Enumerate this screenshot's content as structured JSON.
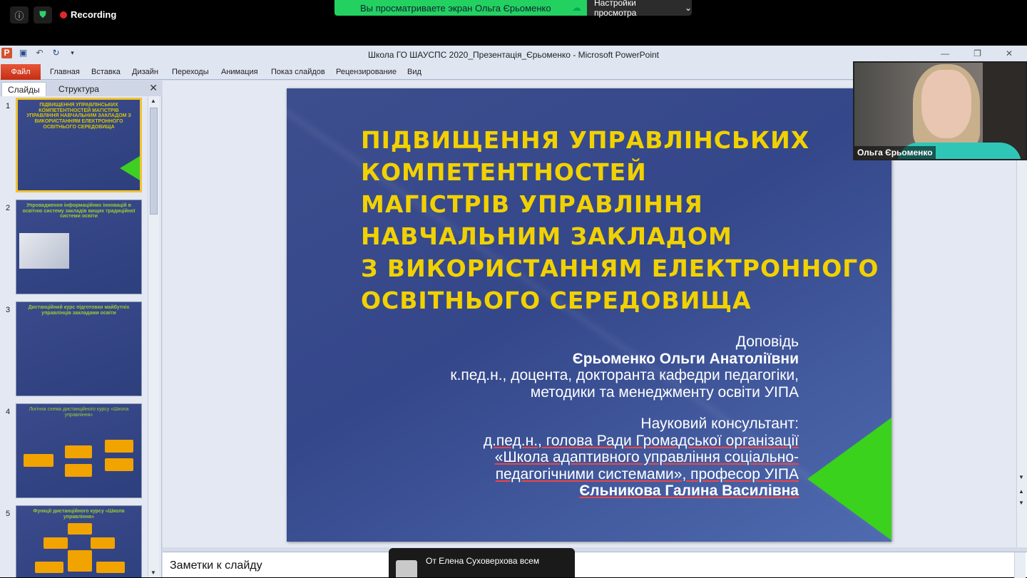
{
  "zoom": {
    "recording_label": "Recording",
    "share_banner": "Вы просматриваете экран Ольга Єрьоменко",
    "view_settings_label": "Настройки просмотра"
  },
  "window": {
    "title": "Школа ГО ШАУСПС 2020_Презентація_Єрьоменко  -  Microsoft PowerPoint"
  },
  "ribbon": {
    "file": "Файл",
    "tabs": [
      "Главная",
      "Вставка",
      "Дизайн",
      "Переходы",
      "Анимация",
      "Показ слайдов",
      "Рецензирование",
      "Вид"
    ]
  },
  "left_panel": {
    "tab_slides": "Слайды",
    "tab_outline": "Структура"
  },
  "thumbnails": [
    {
      "num": "1",
      "title": "ПІДВИЩЕННЯ УПРАВЛІНСЬКИХ КОМПЕТЕНТНОСТЕЙ МАГІСТРІВ УПРАВЛІННЯ НАВЧАЛЬНИМ ЗАКЛАДОМ З ВИКОРИСТАННЯМ ЕЛЕКТРОННОГО ОСВІТНЬОГО СЕРЕДОВИЩА"
    },
    {
      "num": "2",
      "title": "Упровадження інформаційних інновацій в освітню систему закладів вищих традиційної системи освіти"
    },
    {
      "num": "3",
      "title": "Дистанційний курс підготовки майбутніх управлінців закладами освіти"
    },
    {
      "num": "4",
      "title": "Логічна схема дистанційного курсу «Школа управління»"
    },
    {
      "num": "5",
      "title": "Функції дистанційного курсу «Школа управління»"
    }
  ],
  "slide": {
    "title_lines": [
      "ПІДВИЩЕННЯ УПРАВЛІНСЬКИХ",
      "КОМПЕТЕНТНОСТЕЙ",
      "МАГІСТРІВ УПРАВЛІННЯ",
      "НАВЧАЛЬНИМ ЗАКЛАДОМ",
      "З ВИКОРИСТАННЯМ ЕЛЕКТРОННОГО",
      "ОСВІТНЬОГО СЕРЕДОВИЩА"
    ],
    "report_label": "Доповідь",
    "author_name": "Єрьоменко Ольги Анатоліївни",
    "author_title_1": "к.пед.н., доцента, докторанта кафедри педагогіки,",
    "author_title_2": "методики та менеджменту освіти УІПА",
    "consultant_label": "Науковий консультант:",
    "consultant_line_1": "д.пед.н., голова Ради Громадської організації",
    "consultant_line_2": "«Школа адаптивного управління соціально-",
    "consultant_line_3": "педагогічними системами», професор УІПА",
    "consultant_name": "Єльникова Галина Василівна"
  },
  "notes": {
    "placeholder": "Заметки к слайду"
  },
  "chat": {
    "from": "От Елена Суховерхова всем"
  },
  "video": {
    "participant_name": "Ольга Єрьоменко"
  }
}
